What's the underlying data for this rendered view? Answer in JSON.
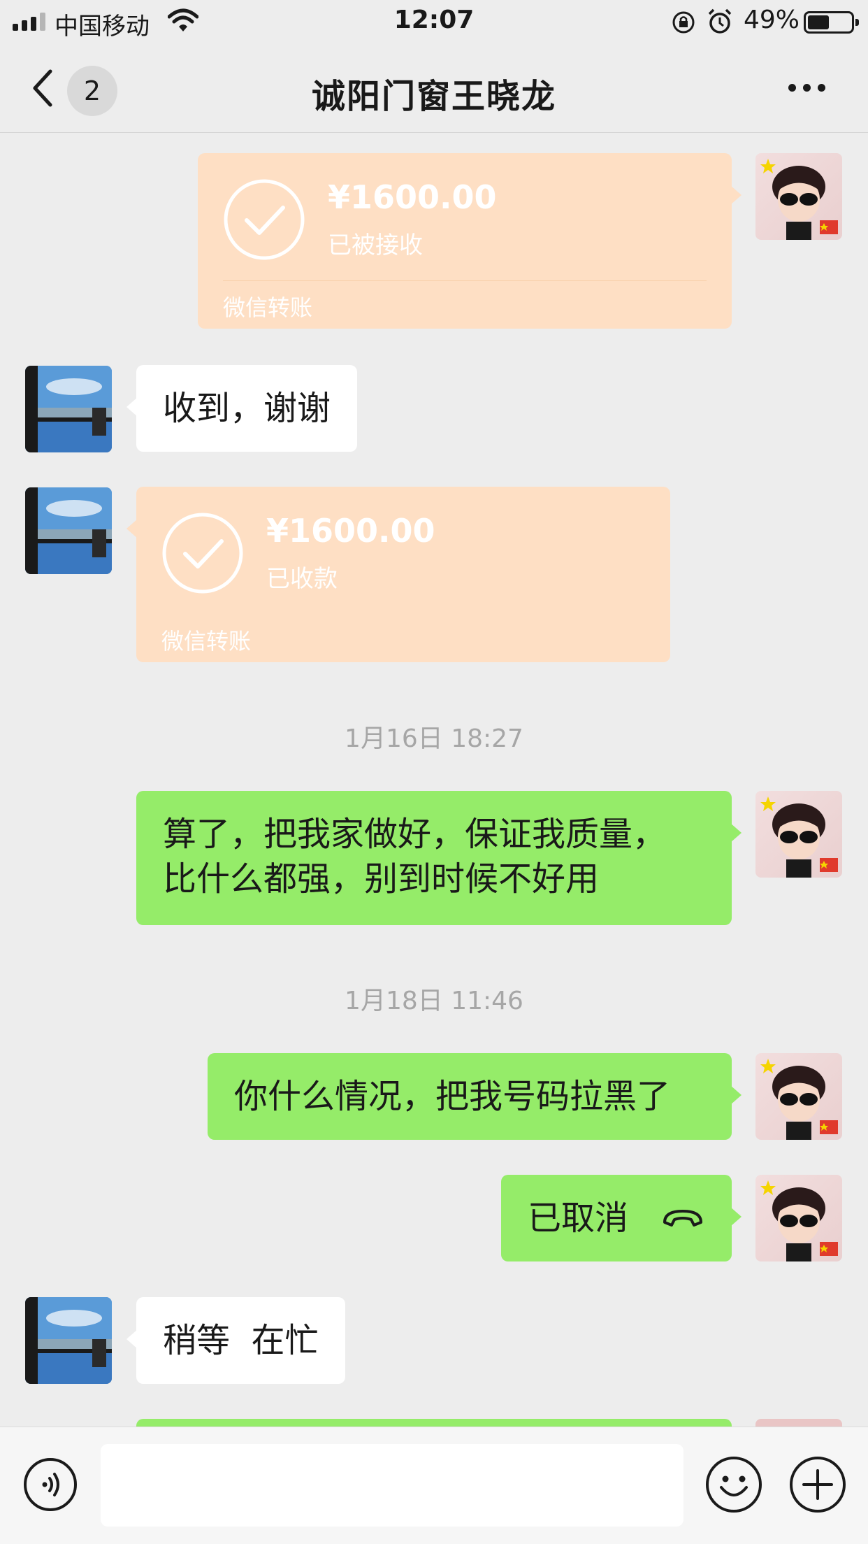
{
  "status_bar": {
    "carrier": "中国移动",
    "time": "12:07",
    "battery": "49%"
  },
  "nav": {
    "back_count": "2",
    "title": "诚阳门窗王晓龙"
  },
  "messages": [
    {
      "type": "transfer",
      "side": "right",
      "amount": "¥1600.00",
      "status": "已被接收",
      "footer": "微信转账"
    },
    {
      "type": "text",
      "side": "left",
      "text": "收到，谢谢"
    },
    {
      "type": "transfer",
      "side": "left",
      "amount": "¥1600.00",
      "status": "已收款",
      "footer": "微信转账"
    },
    {
      "type": "time",
      "text": "1月16日 18:27"
    },
    {
      "type": "text",
      "side": "right",
      "lines": [
        "算了，把我家做好，保证我质量，",
        "比什么都强，别到时候不好用"
      ]
    },
    {
      "type": "time",
      "text": "1月18日 11:46"
    },
    {
      "type": "text",
      "side": "right",
      "text": "你什么情况，把我号码拉黑了"
    },
    {
      "type": "call",
      "side": "right",
      "text": "已取消"
    },
    {
      "type": "text",
      "side": "left",
      "text": "稍等  在忙"
    }
  ],
  "icons": {
    "back": "chevron-left-icon",
    "more": "more-dots-icon",
    "voice": "voice-icon",
    "emoji": "emoji-icon",
    "plus": "plus-icon",
    "call": "phone-hangup-icon",
    "check": "check-circle-icon"
  },
  "colors": {
    "sent_bubble": "#95ec69",
    "received_bubble": "#ffffff",
    "transfer_bubble": "#fedfc4",
    "background": "#ededed"
  }
}
